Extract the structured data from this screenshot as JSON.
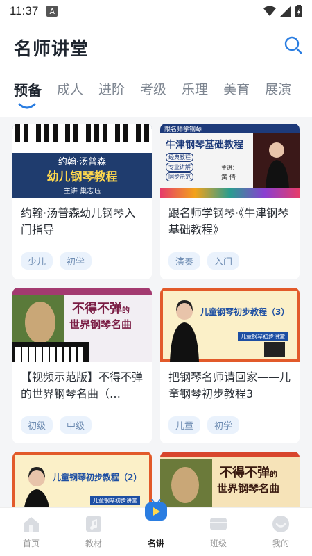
{
  "status": {
    "time": "11:37",
    "notif_letter": "A"
  },
  "header": {
    "title": "名师讲堂"
  },
  "tabs": [
    {
      "label": "预备",
      "active": true
    },
    {
      "label": "成人"
    },
    {
      "label": "进阶"
    },
    {
      "label": "考级"
    },
    {
      "label": "乐理"
    },
    {
      "label": "美育"
    },
    {
      "label": "展演"
    }
  ],
  "cards": [
    {
      "title": "约翰·汤普森幼儿钢琴入门指导",
      "tags": [
        "少儿",
        "初学"
      ],
      "thumb": {
        "line1": "约翰·汤普森",
        "line2": "幼儿钢琴教程",
        "line3": "主讲  巢志珏"
      }
    },
    {
      "title": "跟名师学钢琴·《牛津钢琴基础教程》",
      "tags": [
        "演奏",
        "入门"
      ],
      "thumb": {
        "badge": "跟名师学钢琴",
        "line1": "牛津钢琴基础教程",
        "item1": "经典教程",
        "item2": "专业讲解",
        "item3": "同步示范",
        "teacher": "主讲：",
        "name": "黄 倩"
      }
    },
    {
      "title": "【视频示范版】不得不弹的世界钢琴名曲（…",
      "tags": [
        "初级",
        "中级"
      ],
      "thumb": {
        "line1": "不得不弹",
        "small": "的",
        "line2": "世界钢琴名曲"
      }
    },
    {
      "title": "把钢琴名师请回家——儿童钢琴初步教程3",
      "tags": [
        "儿童",
        "初学"
      ],
      "thumb": {
        "line1": "儿童钢琴初步教程（3）",
        "line2": "儿童钢琴初步讲堂"
      }
    },
    {
      "title": "",
      "tags": [],
      "thumb": {
        "line1": "儿童钢琴初步教程（2）",
        "line2": "儿童钢琴初步讲堂"
      }
    },
    {
      "title": "",
      "tags": [],
      "thumb": {
        "line1": "不得不弹",
        "small": "的",
        "line2": "世界钢琴名曲"
      }
    }
  ],
  "nav": [
    {
      "label": "首页",
      "icon": "home-icon"
    },
    {
      "label": "教材",
      "icon": "music-book-icon"
    },
    {
      "label": "名讲",
      "icon": "play-tv-icon",
      "active": true
    },
    {
      "label": "班级",
      "icon": "class-icon"
    },
    {
      "label": "我的",
      "icon": "profile-icon"
    }
  ]
}
